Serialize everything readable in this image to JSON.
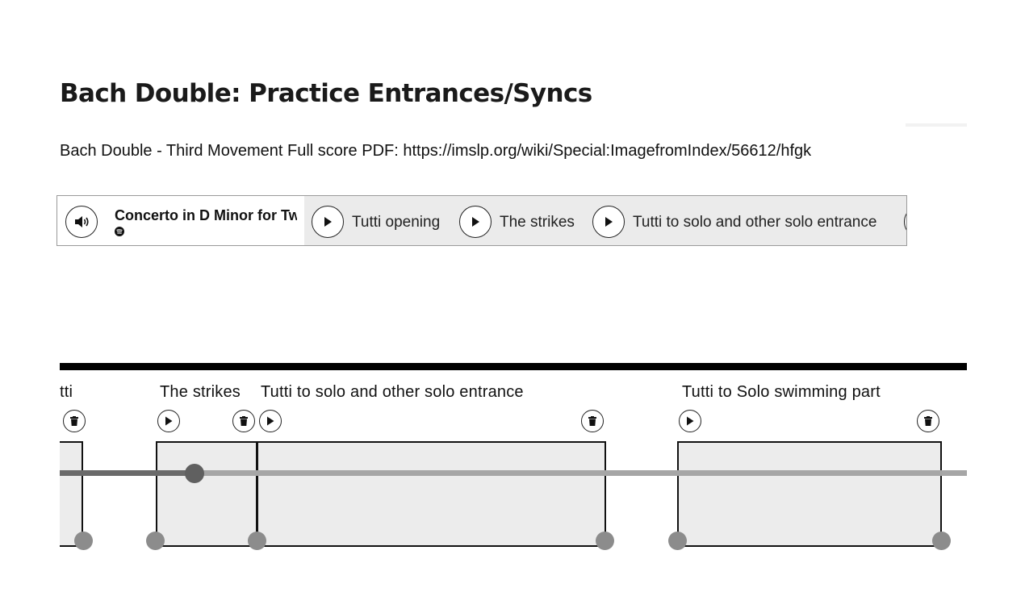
{
  "page": {
    "title": "Bach Double: Practice Entrances/Syncs",
    "description": "Bach Double - Third Movement Full score PDF: https://imslp.org/wiki/Special:ImagefromIndex/56612/hfgk"
  },
  "player": {
    "track_title": "Concerto in D Minor for Two Violins",
    "service_icon": "spotify-icon",
    "segments": [
      {
        "label": "Tutti opening"
      },
      {
        "label": "The strikes"
      },
      {
        "label": "Tutti to solo and other solo entrance"
      }
    ]
  },
  "timeline": {
    "segments": [
      {
        "label": "tti"
      },
      {
        "label": "The strikes"
      },
      {
        "label": "Tutti to solo and other solo entrance"
      },
      {
        "label": "Tutti to Solo swimming part"
      }
    ]
  },
  "colors": {
    "text": "#111111",
    "player_bg": "#ebebeb",
    "region_fill": "#ececec",
    "track": "#a6a6a6",
    "track_played": "#6a6a6a",
    "handle": "#8c8c8c"
  }
}
